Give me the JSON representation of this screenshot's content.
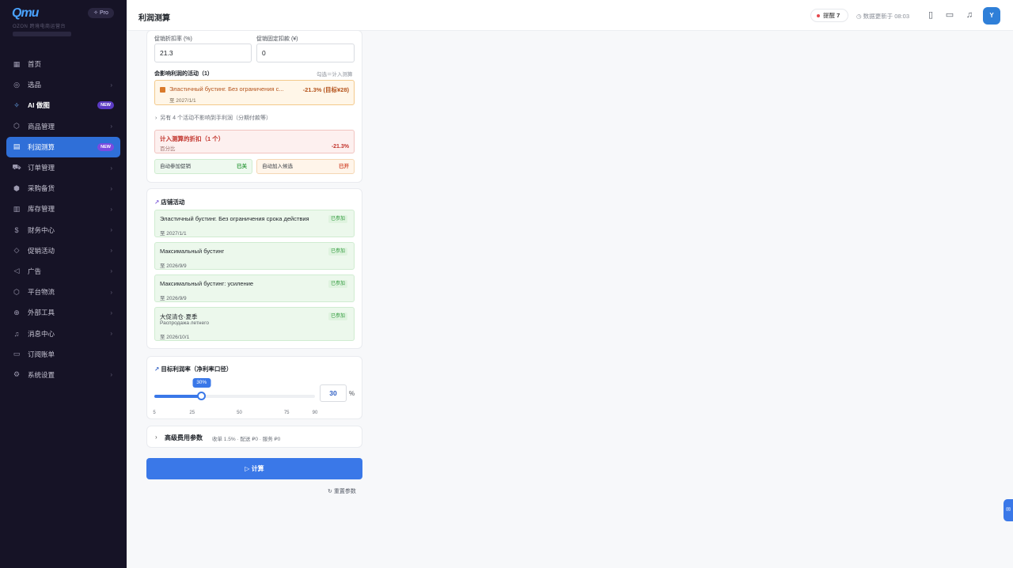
{
  "sidebar": {
    "logo": "Qmu",
    "pro_label": "✧ Pro",
    "subtitle": "OZON 跨境电商运营台",
    "items": [
      {
        "label": "首页",
        "icon": "dashboard-icon",
        "chevron": false,
        "badge": ""
      },
      {
        "label": "选品",
        "icon": "target-icon",
        "chevron": true,
        "badge": ""
      },
      {
        "label": "AI 做图",
        "icon": "sparkle-icon",
        "chevron": false,
        "badge": "NEW"
      },
      {
        "label": "商品管理",
        "icon": "box-icon",
        "chevron": true,
        "badge": ""
      },
      {
        "label": "利润测算",
        "icon": "calculator-icon",
        "chevron": false,
        "badge": "NEW"
      },
      {
        "label": "订单管理",
        "icon": "cart-icon",
        "chevron": true,
        "badge": ""
      },
      {
        "label": "采购备货",
        "icon": "package-icon",
        "chevron": true,
        "badge": ""
      },
      {
        "label": "库存管理",
        "icon": "warehouse-icon",
        "chevron": true,
        "badge": ""
      },
      {
        "label": "财务中心",
        "icon": "dollar-icon",
        "chevron": true,
        "badge": ""
      },
      {
        "label": "促销活动",
        "icon": "tag-icon",
        "chevron": true,
        "badge": ""
      },
      {
        "label": "广告",
        "icon": "megaphone-icon",
        "chevron": true,
        "badge": ""
      },
      {
        "label": "平台物流",
        "icon": "truck-icon",
        "chevron": true,
        "badge": ""
      },
      {
        "label": "外部工具",
        "icon": "globe-icon",
        "chevron": true,
        "badge": ""
      },
      {
        "label": "消息中心",
        "icon": "bell-icon",
        "chevron": true,
        "badge": ""
      },
      {
        "label": "订阅账单",
        "icon": "card-icon",
        "chevron": false,
        "badge": ""
      },
      {
        "label": "系统设置",
        "icon": "gear-icon",
        "chevron": true,
        "badge": ""
      }
    ],
    "active_index": 4
  },
  "header": {
    "title": "利润测算",
    "alert_label": "提醒",
    "alert_count": "7",
    "update_text": "数据更新于 08:03",
    "avatar": "Y"
  },
  "promo_card": {
    "discount_label": "促销折扣率 (%)",
    "discount_value": "21.3",
    "fixed_label": "促销固定扣款 (¥)",
    "fixed_value": "0",
    "affecting_title": "会影响利润的活动（1）",
    "affecting_hint": "勾选＝计入测算",
    "promo_name": "Эластичный бустинг. Без ограничения с...",
    "promo_rate": "-21.3% (目标¥28)",
    "promo_date": "至 2027/1/1",
    "other_text": "另有 4 个活动不影响到手利润（分期付款等）",
    "disc_title": "计入测算的折扣（1 个）",
    "disc_sub": "百分比",
    "disc_value": "-21.3%",
    "chip1_label": "自动参加促销",
    "chip1_status": "已关",
    "chip2_label": "自动加入候选",
    "chip2_status": "已开"
  },
  "store": {
    "title": "店铺活动",
    "items": [
      {
        "name": "Эластичный бустинг. Без ограничения срока действия",
        "sub": "",
        "date": "至 2027/1/1",
        "status": "已参加"
      },
      {
        "name": "Максимальный бустинг",
        "sub": "",
        "date": "至 2026/9/9",
        "status": "已参加"
      },
      {
        "name": "Максимальный бустинг: усиление",
        "sub": "",
        "date": "至 2026/9/9",
        "status": "已参加"
      },
      {
        "name": "大促清仓·夏季",
        "sub": "Распродажа летнего",
        "date": "至 2026/10/1",
        "status": "已参加"
      }
    ]
  },
  "target": {
    "title": "目标利润率（净利率口径）",
    "value": 30,
    "value_label": "30%",
    "input_value": "30",
    "unit": "%",
    "min": 5,
    "max": 90,
    "ticks": [
      "5",
      "25",
      "50",
      "75",
      "90"
    ]
  },
  "advanced": {
    "title": "高级费用参数",
    "summary": "收单 1.5% · 配送 ₽0 · 服务 ₽0"
  },
  "actions": {
    "calc_label": "计算",
    "reset_label": "重置参数"
  },
  "colors": {
    "primary": "#3a78e8",
    "sidebar_bg": "#161326",
    "promo_orange": "#b4531c",
    "discount_red": "#d9363e",
    "success_green": "#2f9a3c"
  }
}
